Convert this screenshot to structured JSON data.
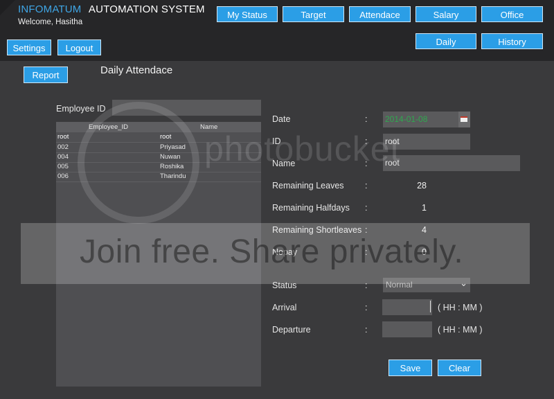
{
  "header": {
    "brand_primary": "INFOMATUM",
    "brand_secondary": "AUTOMATION SYSTEM",
    "welcome": "Welcome, Hasitha",
    "nav_top": [
      "My Status",
      "Target",
      "Attendace",
      "Salary",
      "Office"
    ],
    "nav_sub": [
      "Daily",
      "History"
    ],
    "settings_label": "Settings",
    "logout_label": "Logout"
  },
  "report_label": "Report",
  "page_title": "Daily Attendace",
  "employee_search": {
    "label": "Employee ID",
    "value": ""
  },
  "employee_table": {
    "columns": [
      "Employee_ID",
      "Name"
    ],
    "rows": [
      [
        "root",
        "root"
      ],
      [
        "002",
        "Priyasad"
      ],
      [
        "004",
        "Nuwan"
      ],
      [
        "005",
        "Roshika"
      ],
      [
        "006",
        "Tharindu"
      ]
    ]
  },
  "form": {
    "date_label": "Date",
    "date_value": "2014-01-08",
    "id_label": "ID",
    "id_value": "root",
    "name_label": "Name",
    "name_value": "root",
    "remaining_leaves_label": "Remaining Leaves",
    "remaining_leaves_value": "28",
    "remaining_halfdays_label": "Remaining Halfdays",
    "remaining_halfdays_value": "1",
    "remaining_shortleaves_label": "Remaining Shortleaves",
    "remaining_shortleaves_value": "4",
    "nopay_label": "Nopay",
    "nopay_value": "0",
    "status_label": "Status",
    "status_value": "Normal",
    "arrival_label": "Arrival",
    "arrival_value": "",
    "departure_label": "Departure",
    "departure_value": "",
    "time_hint": "( HH : MM )",
    "colon": ":"
  },
  "actions": {
    "save_label": "Save",
    "clear_label": "Clear"
  },
  "watermark": {
    "photo_text": "photobucket",
    "join_text": "Join free. Share privately."
  },
  "colors": {
    "accent": "#2b9ee6",
    "brand_blue": "#3fa6e6",
    "date_text": "#2fa84f",
    "background": "#3a3a3c",
    "header_bg": "#262628"
  }
}
